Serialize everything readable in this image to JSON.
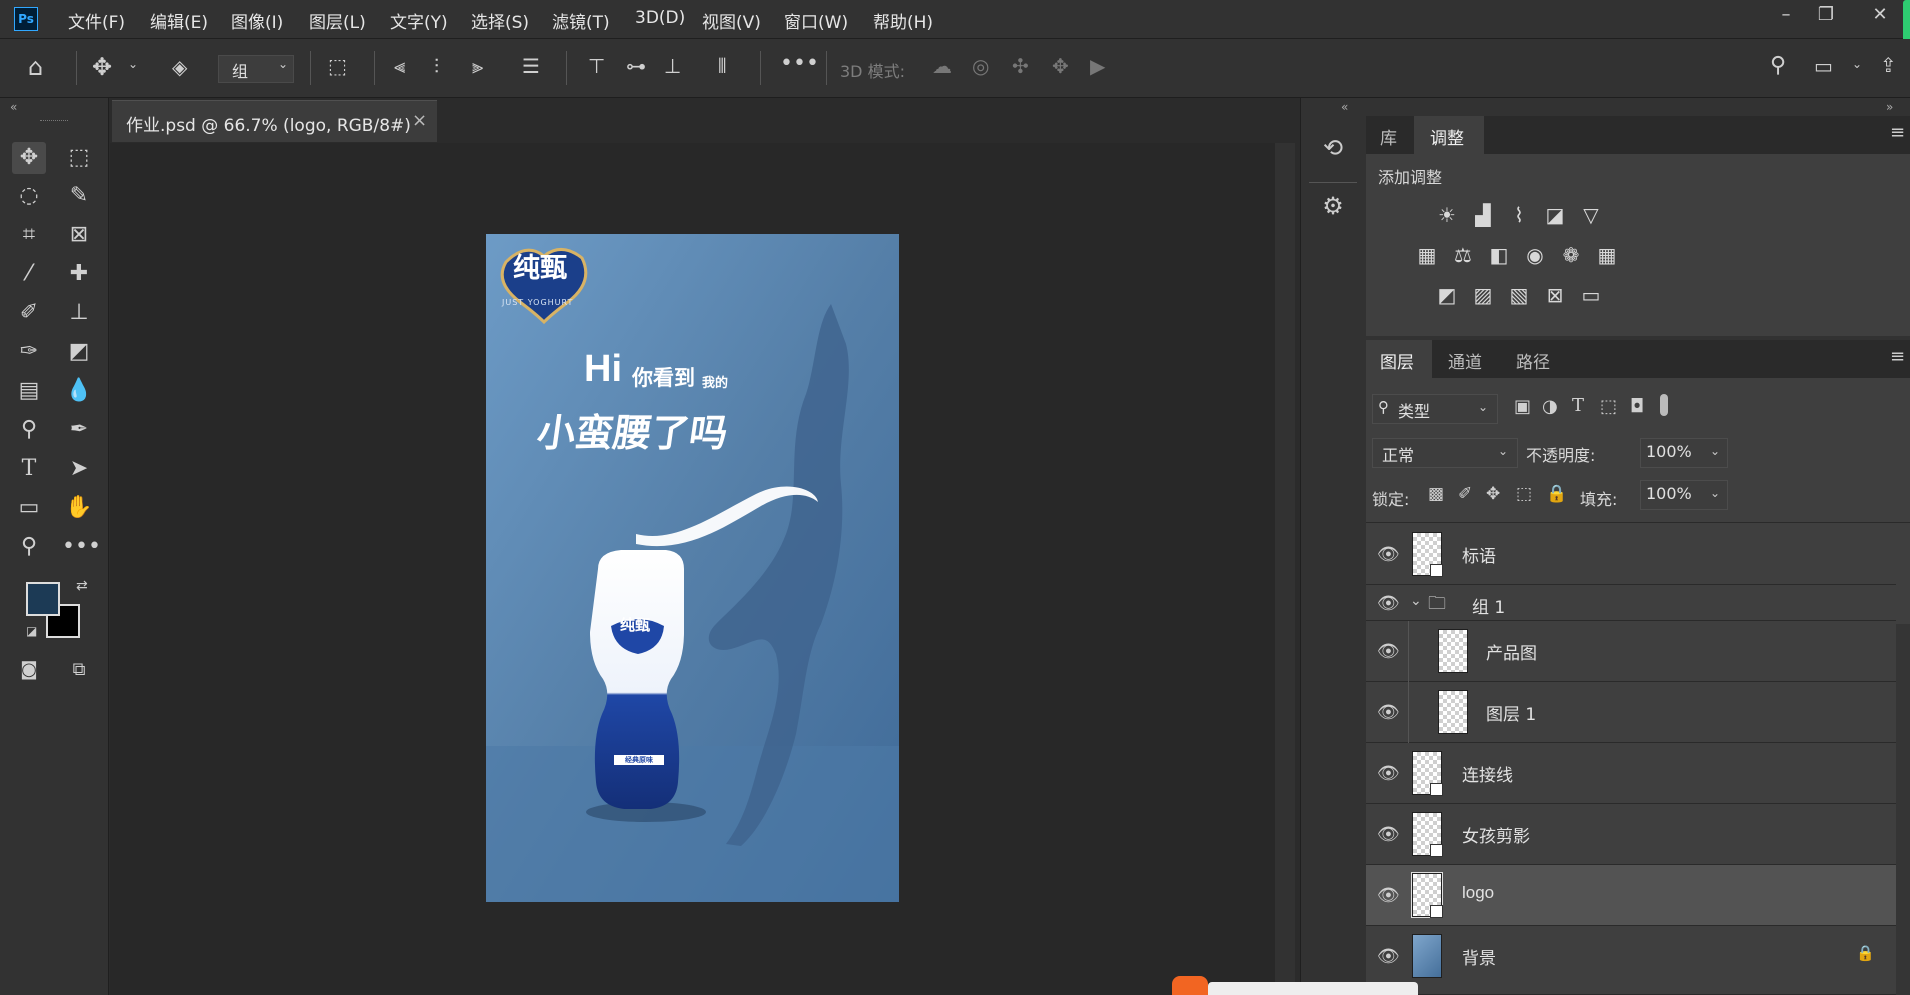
{
  "app": {
    "logo": "Ps"
  },
  "menu": [
    "文件(F)",
    "编辑(E)",
    "图像(I)",
    "图层(L)",
    "文字(Y)",
    "选择(S)",
    "滤镜(T)",
    "3D(D)",
    "视图(V)",
    "窗口(W)",
    "帮助(H)"
  ],
  "window_controls": {
    "minimize": "–",
    "restore": "❐",
    "close": "✕"
  },
  "options_bar": {
    "auto_select_target": "组",
    "threed_mode_label": "3D 模式:"
  },
  "document": {
    "tab_title": "作业.psd @ 66.7% (logo, RGB/8#)",
    "close_glyph": "×"
  },
  "colors": {
    "foreground": "#1c3a55",
    "background": "#000000",
    "ui_bg": "#323232",
    "canvas_bg": "#282828",
    "selected_layer": "#535353",
    "ps_blue": "#31a8ff"
  },
  "artwork": {
    "brand": "纯甄",
    "brand_sub": "JUST YOGHURT",
    "headline_hi": "Hi",
    "headline_small": "你看到",
    "headline_small2": "我的",
    "headline_main": "小蛮腰了吗",
    "bottle_brand": "纯甄",
    "bottle_label": "经典原味"
  },
  "panels": {
    "top_tabs": [
      {
        "label": "库",
        "active": false
      },
      {
        "label": "调整",
        "active": true
      }
    ],
    "add_adjustment": "添加调整",
    "layer_tabs": [
      {
        "label": "图层",
        "active": true
      },
      {
        "label": "通道",
        "active": false
      },
      {
        "label": "路径",
        "active": false
      }
    ],
    "filter_kind": "类型",
    "blend_mode": "正常",
    "opacity_label": "不透明度:",
    "opacity_value": "100%",
    "lock_label": "锁定:",
    "fill_label": "填充:",
    "fill_value": "100%"
  },
  "layers": [
    {
      "name": "标语",
      "type": "smart",
      "selected": false,
      "indent": 0
    },
    {
      "name": "组 1",
      "type": "group",
      "selected": false,
      "indent": 0
    },
    {
      "name": "产品图",
      "type": "pixel",
      "selected": false,
      "indent": 1
    },
    {
      "name": "图层 1",
      "type": "pixel",
      "selected": false,
      "indent": 1
    },
    {
      "name": "连接线",
      "type": "smart",
      "selected": false,
      "indent": 0
    },
    {
      "name": "女孩剪影",
      "type": "smart",
      "selected": false,
      "indent": 0
    },
    {
      "name": "logo",
      "type": "smart",
      "selected": true,
      "indent": 0
    },
    {
      "name": "背景",
      "type": "image",
      "selected": false,
      "indent": 0,
      "locked": true
    }
  ]
}
